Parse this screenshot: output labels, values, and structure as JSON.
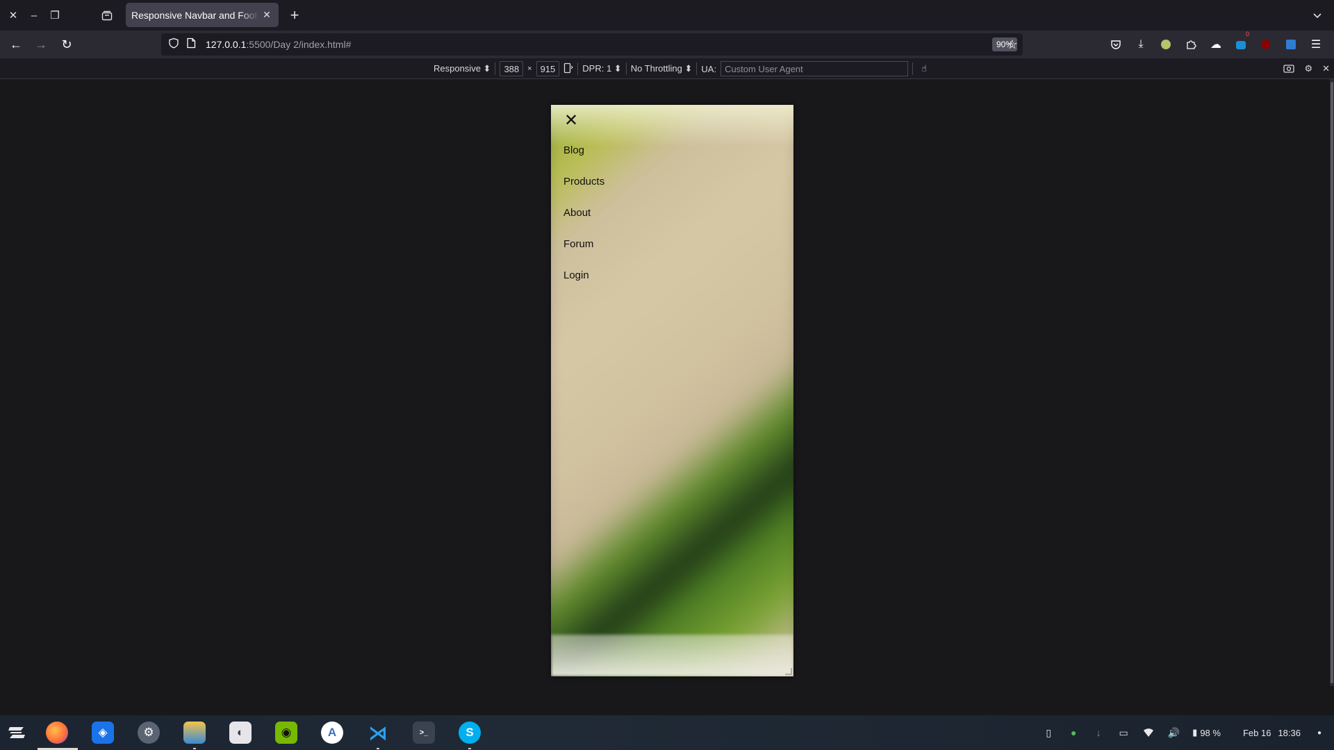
{
  "browser": {
    "tab_title": "Responsive Navbar and Footer",
    "url_host": "127.0.0.1",
    "url_rest": ":5500/Day 2/index.html#",
    "zoom": "90%"
  },
  "rdm": {
    "device_mode": "Responsive ⬍",
    "width": "388",
    "times": "×",
    "height": "915",
    "dpr": "DPR: 1 ⬍",
    "throttling": "No Throttling ⬍",
    "ua_label": "UA:",
    "ua_placeholder": "Custom User Agent"
  },
  "page": {
    "close_symbol": "✕",
    "menu": [
      "Blog",
      "Products",
      "About",
      "Forum",
      "Login"
    ]
  },
  "tray": {
    "battery": "98 %",
    "date": "Feb 16",
    "time": "18:36"
  },
  "ext_badge": "0"
}
